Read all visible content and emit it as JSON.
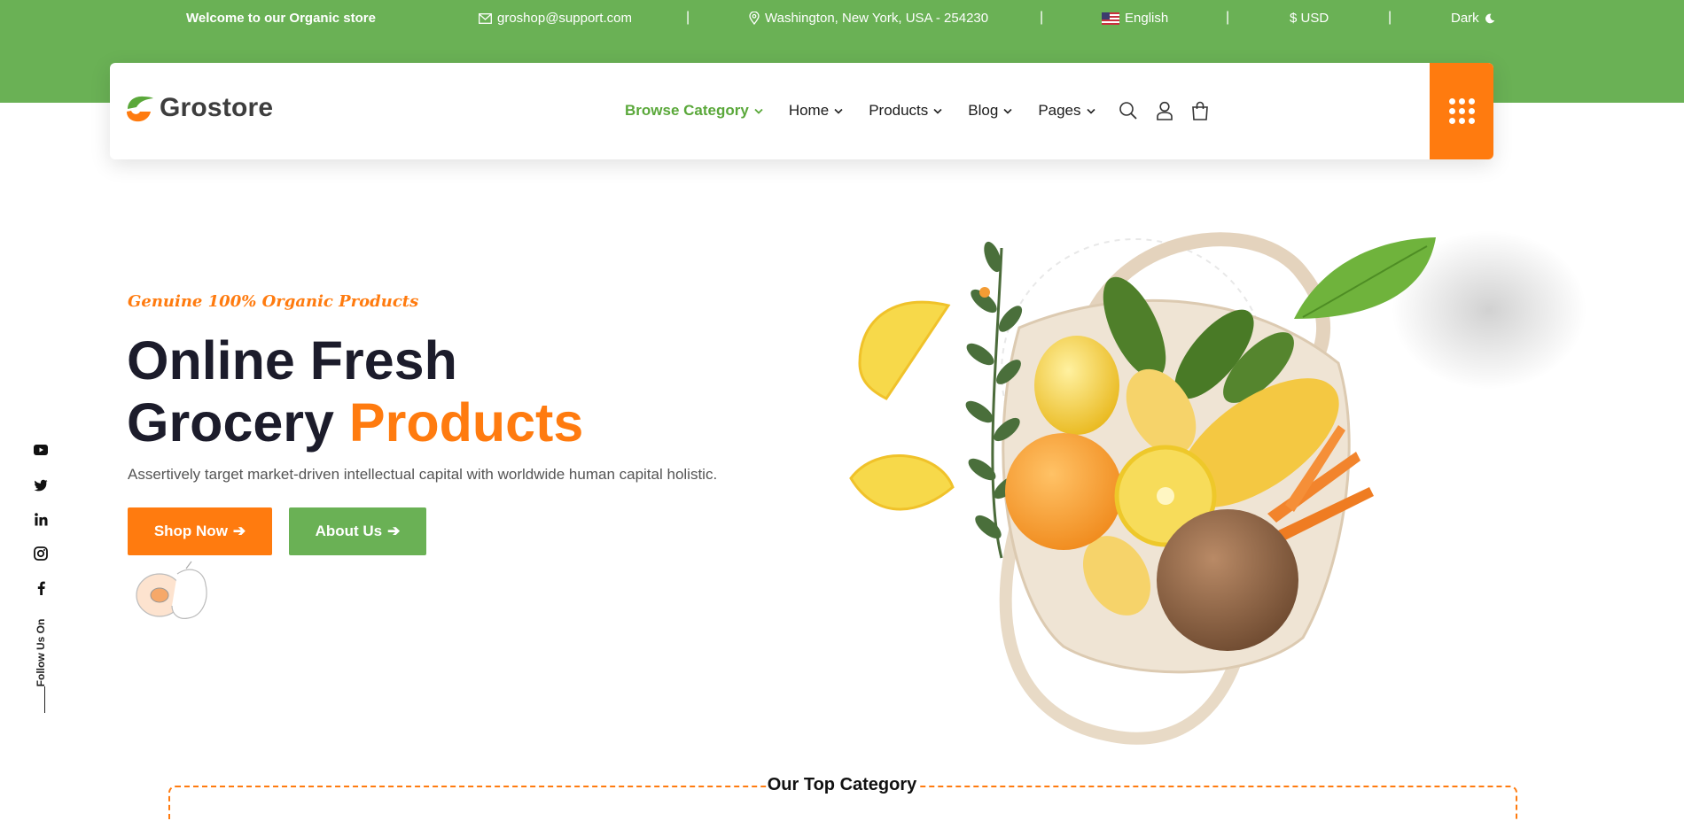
{
  "topbar": {
    "welcome": "Welcome to our Organic store",
    "email": "groshop@support.com",
    "address": "Washington, New York, USA - 254230",
    "language": "English",
    "currency": "$ USD",
    "theme": "Dark",
    "separator": "|",
    "icons": [
      "mail-icon",
      "location-pin-icon",
      "us-flag-icon",
      "moon-icon"
    ]
  },
  "brand": {
    "name": "Grostore",
    "colors": {
      "green": "#6ab155",
      "orange": "#ff7b0f"
    }
  },
  "nav": {
    "browse": "Browse Category",
    "home": "Home",
    "products": "Products",
    "blog": "Blog",
    "pages": "Pages",
    "icons": [
      "search-icon",
      "user-icon",
      "shopping-bag-icon",
      "grid-menu-icon"
    ]
  },
  "hero": {
    "tagline": "Genuine 100% Organic Products",
    "title_line1": "Online Fresh",
    "title_line2_plain": "Grocery",
    "title_line2_accent": "Products",
    "description": "Assertively target market-driven intellectual capital with worldwide human capital holistic.",
    "shop_btn": "Shop Now",
    "about_btn": "About Us"
  },
  "social": {
    "label": "Follow Us On",
    "icons": [
      "youtube-icon",
      "twitter-icon",
      "linkedin-icon",
      "instagram-icon",
      "facebook-icon"
    ]
  },
  "categories": {
    "title": "Our Top Category"
  }
}
